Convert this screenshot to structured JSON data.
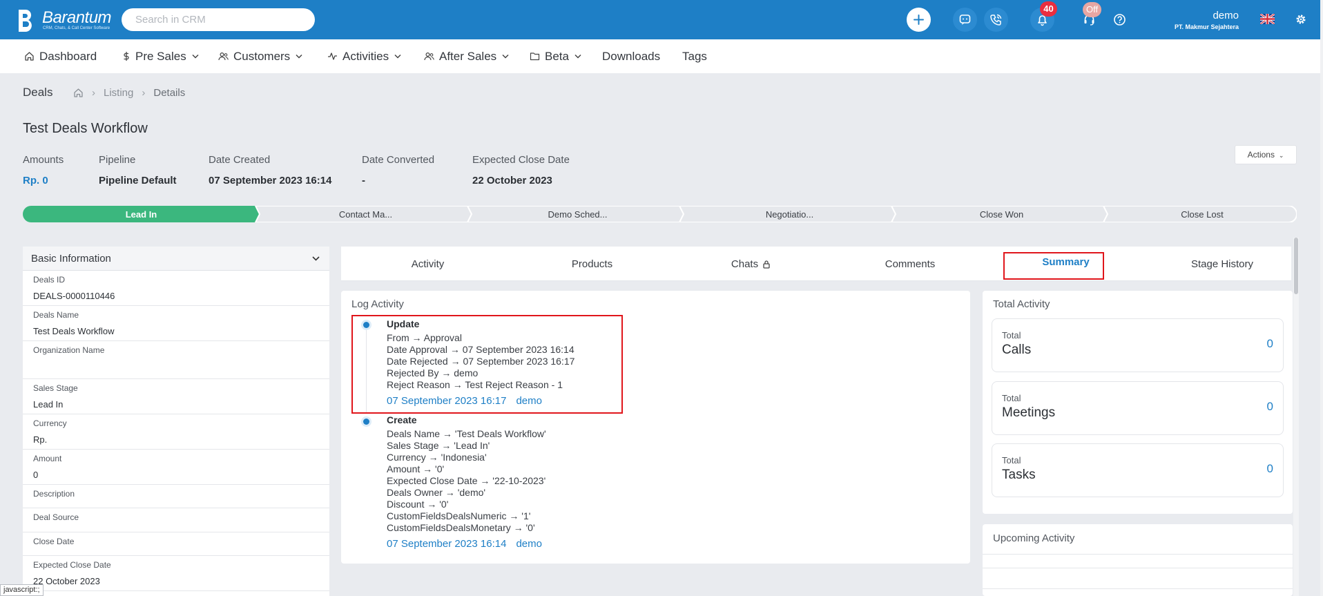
{
  "app": {
    "brand_name": "Barantum",
    "brand_tagline": "CRM, Chats, & Call Center Software",
    "search_placeholder": "Search in CRM",
    "notifications_count": "40",
    "call_status": "Off",
    "user_name": "demo",
    "user_org": "PT. Makmur Sejahtera"
  },
  "nav": {
    "items": [
      {
        "label": "Dashboard",
        "icon": "home-icon"
      },
      {
        "label": "Pre Sales",
        "icon": "dollar-icon"
      },
      {
        "label": "Customers",
        "icon": "users-icon"
      },
      {
        "label": "Activities",
        "icon": "activity-icon"
      },
      {
        "label": "After Sales",
        "icon": "users-icon"
      },
      {
        "label": "Beta",
        "icon": "folder-icon"
      },
      {
        "label": "Downloads"
      },
      {
        "label": "Tags"
      }
    ]
  },
  "breadcrumb": {
    "module": "Deals",
    "items": [
      "Listing",
      "Details"
    ]
  },
  "deal": {
    "title": "Test Deals Workflow",
    "actions_label": "Actions",
    "meta": [
      {
        "label": "Amounts",
        "value": "Rp. 0"
      },
      {
        "label": "Pipeline",
        "value": "Pipeline Default"
      },
      {
        "label": "Date Created",
        "value": "07 September 2023 16:14"
      },
      {
        "label": "Date Converted",
        "value": "-"
      },
      {
        "label": "Expected Close Date",
        "value": "22 October 2023"
      }
    ]
  },
  "stages": {
    "items": [
      "Lead In",
      "Contact Ma...",
      "Demo Sched...",
      "Negotiatio...",
      "Close Won",
      "Close Lost"
    ],
    "active_index": 0,
    "active_color": "#3bb77e"
  },
  "basic_info": {
    "title": "Basic Information",
    "fields": [
      {
        "label": "Deals ID",
        "value": "DEALS-0000110446"
      },
      {
        "label": "Deals Name",
        "value": "Test Deals Workflow"
      },
      {
        "label": "Organization Name",
        "value": ""
      },
      {
        "label": "Sales Stage",
        "value": "Lead In"
      },
      {
        "label": "Currency",
        "value": "Rp."
      },
      {
        "label": "Amount",
        "value": "0"
      },
      {
        "label": "Description",
        "value": ""
      },
      {
        "label": "Deal Source",
        "value": ""
      },
      {
        "label": "Close Date",
        "value": ""
      },
      {
        "label": "Expected Close Date",
        "value": "22 October 2023"
      }
    ]
  },
  "tabs": {
    "items": [
      "Activity",
      "Products",
      "Chats",
      "Comments",
      "Summary",
      "Stage History"
    ],
    "active": "Summary"
  },
  "log_activity": {
    "title": "Log Activity",
    "entries": [
      {
        "title": "Update",
        "lines": [
          "From → Approval",
          "Date Approval → 07 September 2023 16:14",
          "Date Rejected → 07 September 2023 16:17",
          "Rejected By → demo",
          "Reject Reason → Test Reject Reason - 1"
        ],
        "datetime": "07 September 2023 16:17",
        "user": "demo"
      },
      {
        "title": "Create",
        "lines": [
          "Deals Name → 'Test Deals Workflow'",
          "Sales Stage → 'Lead In'",
          "Currency → 'Indonesia'",
          "Amount → '0'",
          "Expected Close Date → '22-10-2023'",
          "Deals Owner → 'demo'",
          "Discount → '0'",
          "CustomFieldsDealsNumeric → '1'",
          "CustomFieldsDealsMonetary → '0'"
        ],
        "datetime": "07 September 2023 16:14",
        "user": "demo"
      }
    ]
  },
  "total_activity": {
    "title": "Total Activity",
    "items": [
      {
        "label": "Total",
        "name": "Calls",
        "value": "0"
      },
      {
        "label": "Total",
        "name": "Meetings",
        "value": "0"
      },
      {
        "label": "Total",
        "name": "Tasks",
        "value": "0"
      }
    ]
  },
  "upcoming_activity": {
    "title": "Upcoming Activity"
  },
  "status_bar": {
    "text": "javascript:;"
  },
  "colors": {
    "primary": "#1e7fc6",
    "highlight": "#e0151b",
    "stage_active": "#3bb77e"
  }
}
